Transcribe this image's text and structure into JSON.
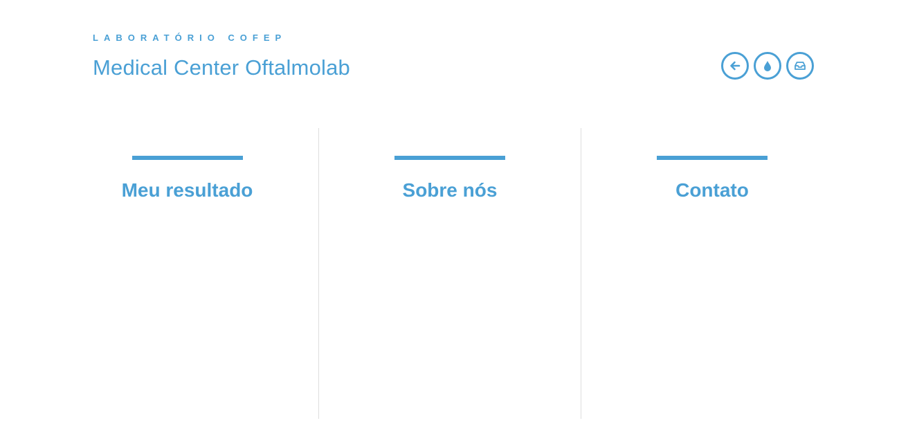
{
  "header": {
    "subtitle": "LABORATÓRIO COFEP",
    "title": "Medical Center Oftalmolab"
  },
  "toolbar": {
    "icons": [
      "back-arrow-icon",
      "drop-icon",
      "inbox-icon"
    ]
  },
  "sections": [
    {
      "label": "Meu resultado"
    },
    {
      "label": "Sobre nós"
    },
    {
      "label": "Contato"
    }
  ],
  "colors": {
    "accent": "#4aa0d5",
    "divider": "#dddddd",
    "background": "#ffffff"
  }
}
